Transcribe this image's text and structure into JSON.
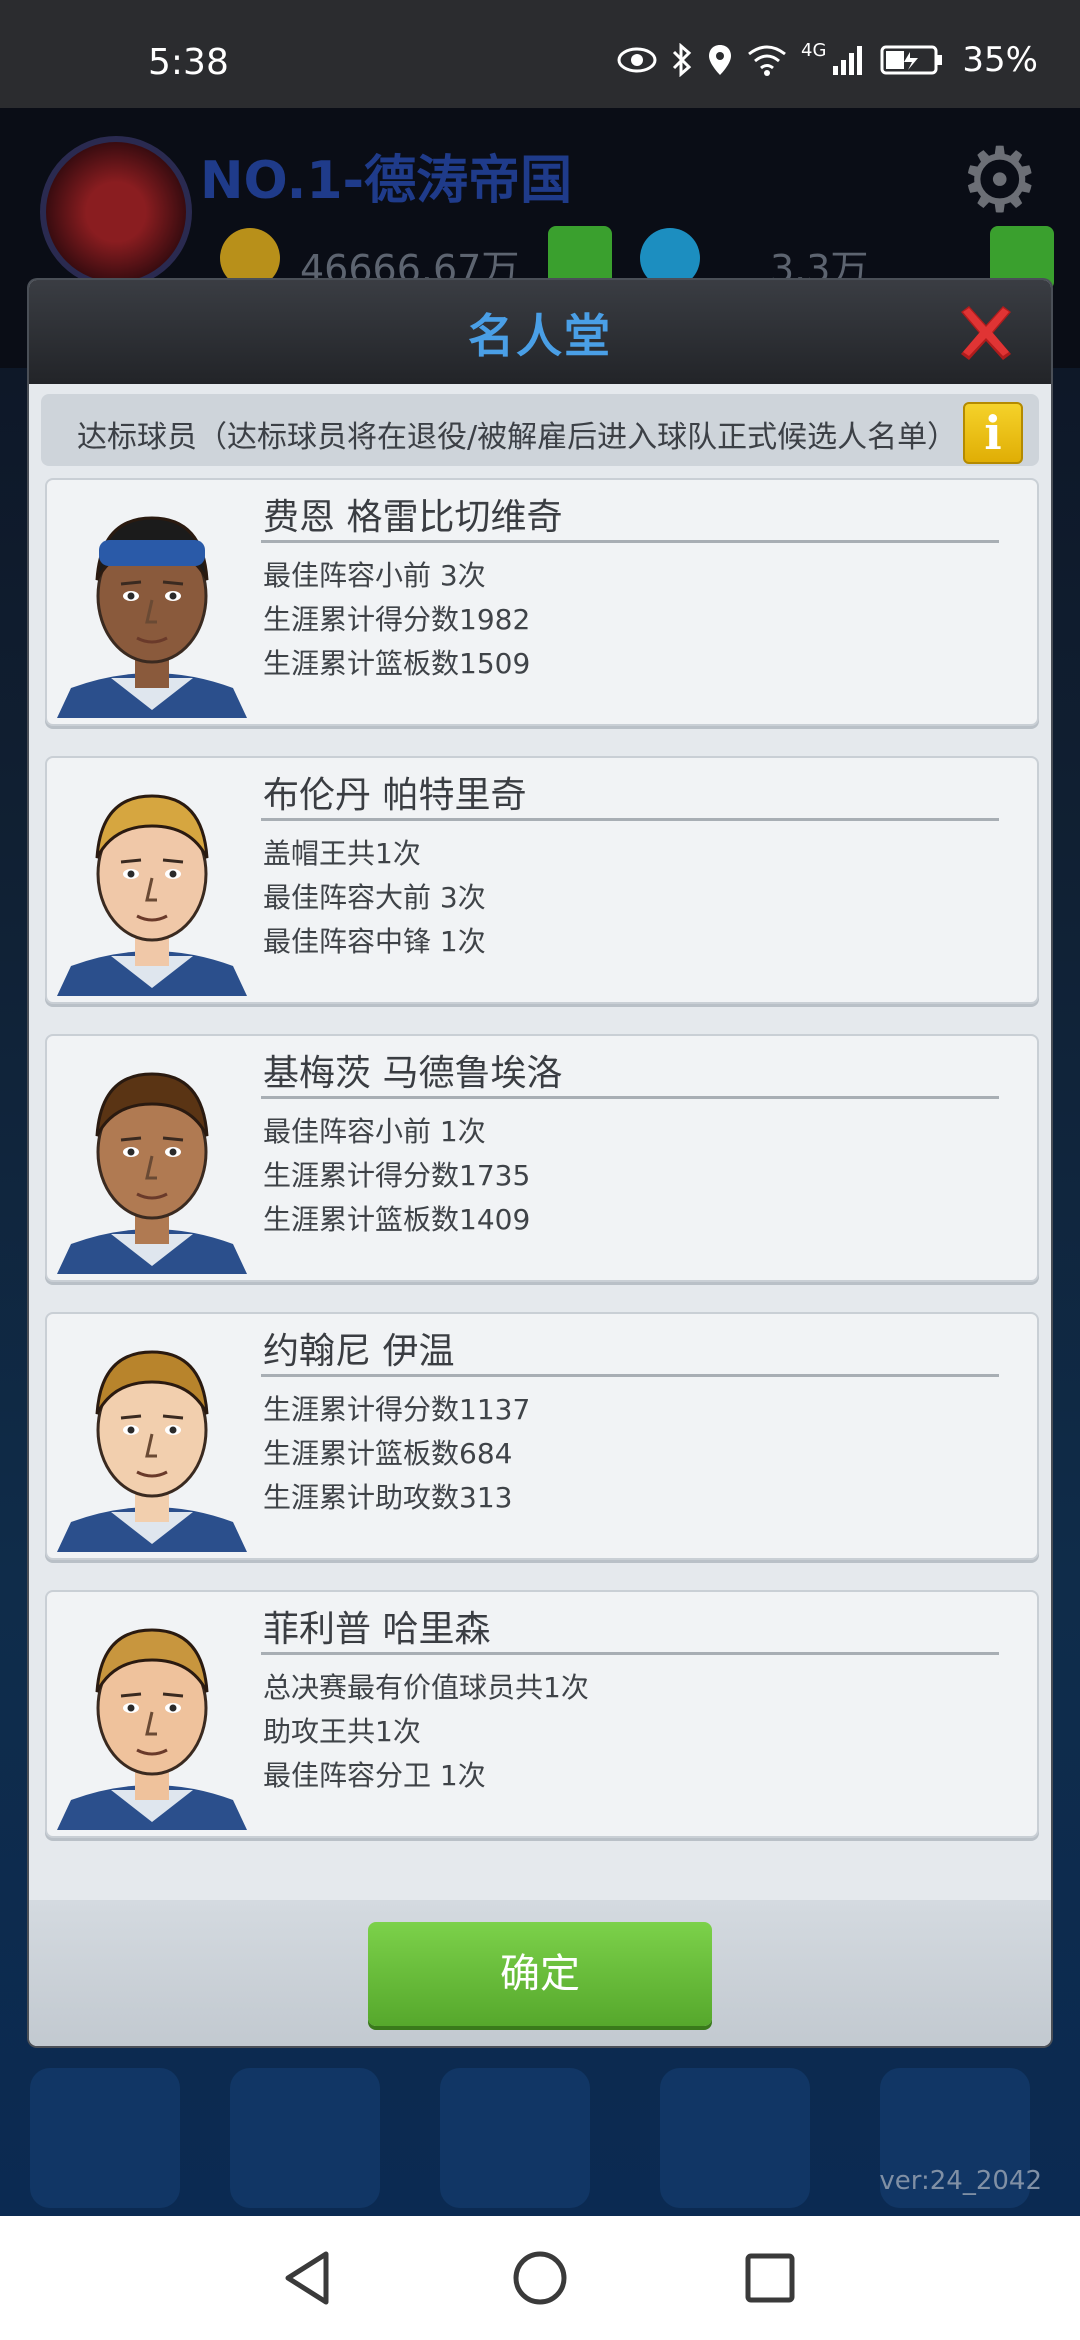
{
  "status_bar": {
    "time": "5:38",
    "network": "4G",
    "battery_percent": "35%",
    "icons": [
      "eye-icon",
      "bluetooth-icon",
      "location-icon",
      "wifi-icon",
      "signal-icon",
      "battery-icon"
    ]
  },
  "background": {
    "team_name": "NO.1-德涛帝国",
    "coins": "46666.67万",
    "gems": "3.3万",
    "version": "ver:24_2042"
  },
  "modal": {
    "title": "名人堂",
    "notice": "达标球员（达标球员将在退役/被解雇后进入球队正式候选人名单）",
    "info_label": "i",
    "confirm_label": "确定",
    "players": [
      {
        "name": "费恩 格雷比切维奇",
        "stats": [
          "最佳阵容小前 3次",
          "生涯累计得分数1982",
          "生涯累计篮板数1509"
        ],
        "skin": "#8a5a3c",
        "hair": "#1b1b1b",
        "headband": "#2a5aa8"
      },
      {
        "name": "布伦丹 帕特里奇",
        "stats": [
          "盖帽王共1次",
          "最佳阵容大前 3次",
          "最佳阵容中锋 1次"
        ],
        "skin": "#f0c8a8",
        "hair": "#d6a640",
        "headband": ""
      },
      {
        "name": "基梅茨 马德鲁埃洛",
        "stats": [
          "最佳阵容小前 1次",
          "生涯累计得分数1735",
          "生涯累计篮板数1409"
        ],
        "skin": "#b07a52",
        "hair": "#5a3414",
        "headband": ""
      },
      {
        "name": "约翰尼 伊温",
        "stats": [
          "生涯累计得分数1137",
          "生涯累计篮板数684",
          "生涯累计助攻数313"
        ],
        "skin": "#f2cfae",
        "hair": "#b8842c",
        "headband": ""
      },
      {
        "name": "菲利普 哈里森",
        "stats": [
          "总决赛最有价值球员共1次",
          "助攻王共1次",
          "最佳阵容分卫 1次"
        ],
        "skin": "#efc29c",
        "hair": "#c8963e",
        "headband": ""
      }
    ]
  },
  "colors": {
    "title_blue": "#4a9fe6",
    "confirm_green": "#6abc3a",
    "close_red": "#d42a2a",
    "info_yellow": "#f0c418"
  }
}
